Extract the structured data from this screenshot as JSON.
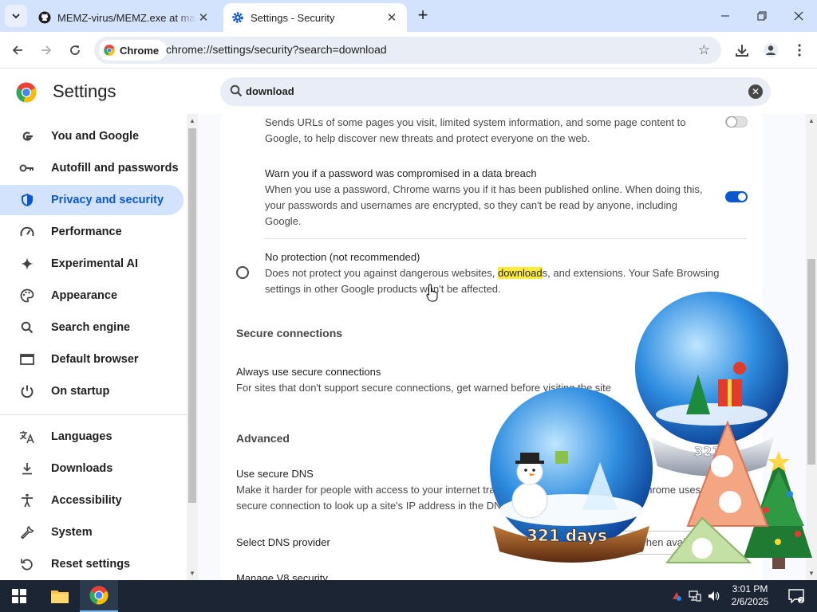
{
  "tabs": [
    {
      "title": "MEMZ-virus/MEMZ.exe at main",
      "icon": "github-icon",
      "active": false
    },
    {
      "title": "Settings - Security",
      "icon": "gear-icon",
      "active": true
    }
  ],
  "toolbar": {
    "chip_label": "Chrome",
    "url": "chrome://settings/security?search=download"
  },
  "header": {
    "title": "Settings",
    "search_value": "download"
  },
  "sidebar": {
    "items": [
      {
        "label": "You and Google",
        "icon": "google-g-icon"
      },
      {
        "label": "Autofill and passwords",
        "icon": "key-icon"
      },
      {
        "label": "Privacy and security",
        "icon": "shield-icon",
        "selected": true
      },
      {
        "label": "Performance",
        "icon": "speedometer-icon"
      },
      {
        "label": "Experimental AI",
        "icon": "sparkle-icon"
      },
      {
        "label": "Appearance",
        "icon": "palette-icon"
      },
      {
        "label": "Search engine",
        "icon": "search-icon"
      },
      {
        "label": "Default browser",
        "icon": "browser-window-icon"
      },
      {
        "label": "On startup",
        "icon": "power-icon"
      },
      {
        "label": "Languages",
        "icon": "translate-icon"
      },
      {
        "label": "Downloads",
        "icon": "download-icon"
      },
      {
        "label": "Accessibility",
        "icon": "accessibility-icon"
      },
      {
        "label": "System",
        "icon": "wrench-icon"
      },
      {
        "label": "Reset settings",
        "icon": "reset-icon"
      }
    ]
  },
  "main": {
    "url_sharing": {
      "text1": "Sends URLs of some pages you visit, limited system information, and some page content to",
      "text2": "Google, to help discover new threats and protect everyone on the web.",
      "enabled": false
    },
    "password_warn": {
      "title": "Warn you if a password was compromised in a data breach",
      "text1": "When you use a password, Chrome warns you if it has been published online. When doing this,",
      "text2": "your passwords and usernames are encrypted, so they can't be read by anyone, including",
      "text3": "Google.",
      "enabled": true
    },
    "no_protection": {
      "title": "No protection (not recommended)",
      "text1_pre": "Does not protect you against dangerous websites, ",
      "text1_hl": "download",
      "text1_post": "s, and extensions. Your Safe Browsing",
      "text2": "settings in other Google products won't be affected."
    },
    "secure_connections": {
      "heading": "Secure connections",
      "title": "Always use secure connections",
      "text": "For sites that don't support secure connections, get warned before visiting the site"
    },
    "advanced": {
      "heading": "Advanced",
      "dns_title": "Use secure DNS",
      "dns_text1": "Make it harder for people with access to your internet traffic to see which sites you visit. Chrome uses a",
      "dns_text2": "secure connection to look up a site's IP address in the DNS (Domain Name System).",
      "dns_provider_label": "Select DNS provider",
      "dns_provider_value": "OS default (when available)",
      "v8_title": "Manage V8 security"
    }
  },
  "decorations": {
    "globe_text": "321 days",
    "globe_small_text": "321"
  },
  "taskbar": {
    "time": "3:01 PM",
    "date": "2/6/2025"
  },
  "colors": {
    "accent": "#0b57d0",
    "selected_bg": "#d3e3fd",
    "highlight": "#ffeb3b"
  }
}
